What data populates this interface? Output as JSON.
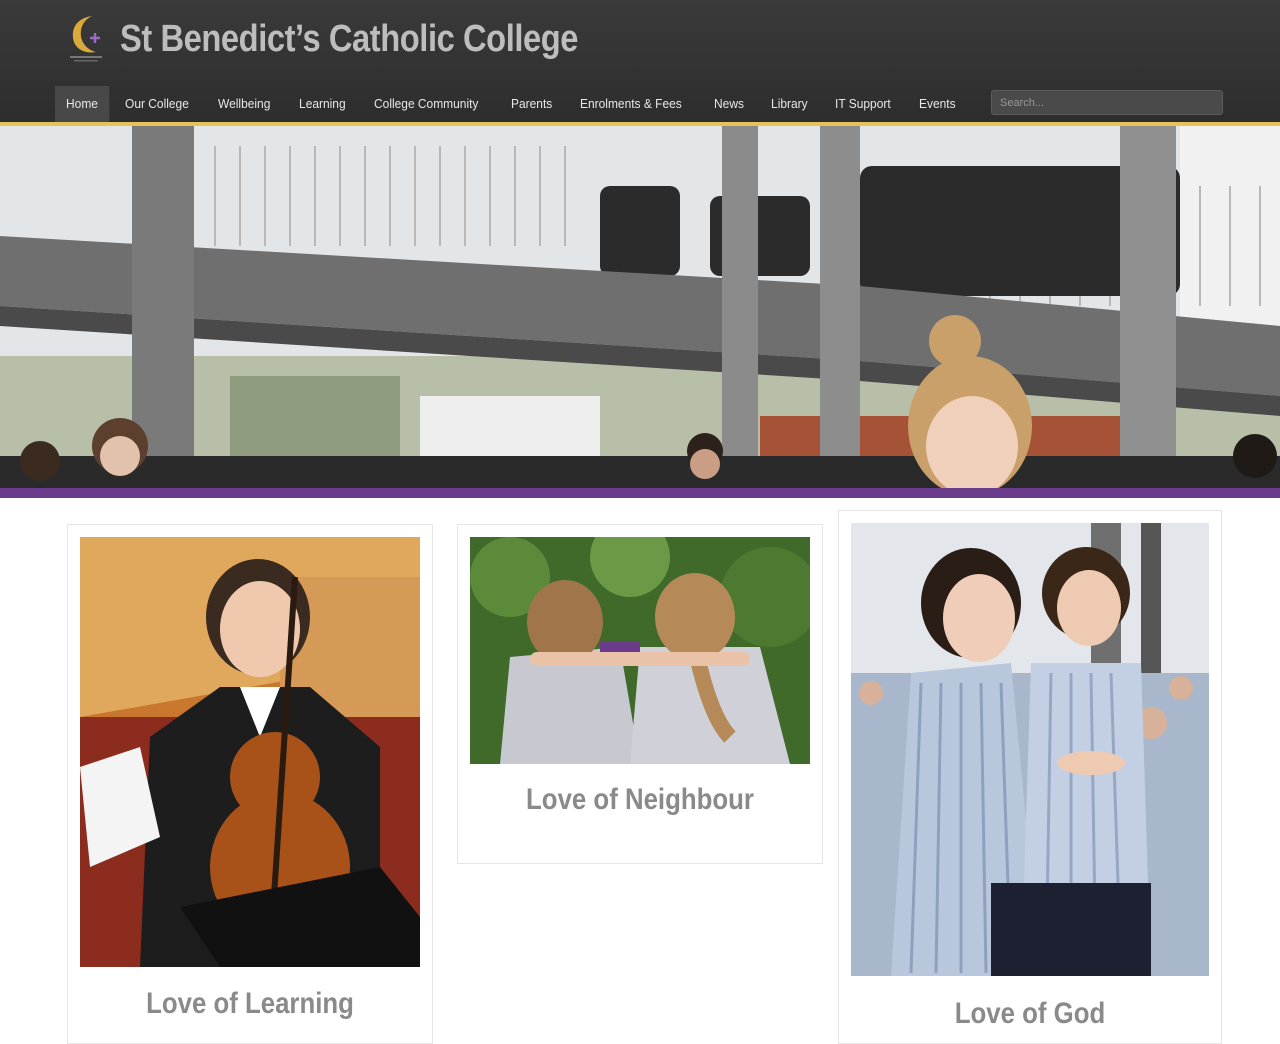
{
  "header": {
    "site_title": "St Benedict’s Catholic College"
  },
  "nav": {
    "items": [
      {
        "label": "Home",
        "active": true
      },
      {
        "label": "Our College"
      },
      {
        "label": "Wellbeing"
      },
      {
        "label": "Learning"
      },
      {
        "label": "College Community"
      },
      {
        "label": "Parents"
      },
      {
        "label": "Enrolments & Fees"
      },
      {
        "label": "News"
      },
      {
        "label": "Library"
      },
      {
        "label": "IT Support"
      },
      {
        "label": "Events"
      }
    ]
  },
  "search": {
    "placeholder": "Search..."
  },
  "colors": {
    "header_bg": "#2f2f2f",
    "accent_gold": "#e7c15a",
    "accent_purple": "#6b3c8c",
    "title_gray": "#8a8a8a"
  },
  "cards": [
    {
      "title": "Love of Learning"
    },
    {
      "title": "Love of Neighbour"
    },
    {
      "title": "Love of God"
    }
  ]
}
